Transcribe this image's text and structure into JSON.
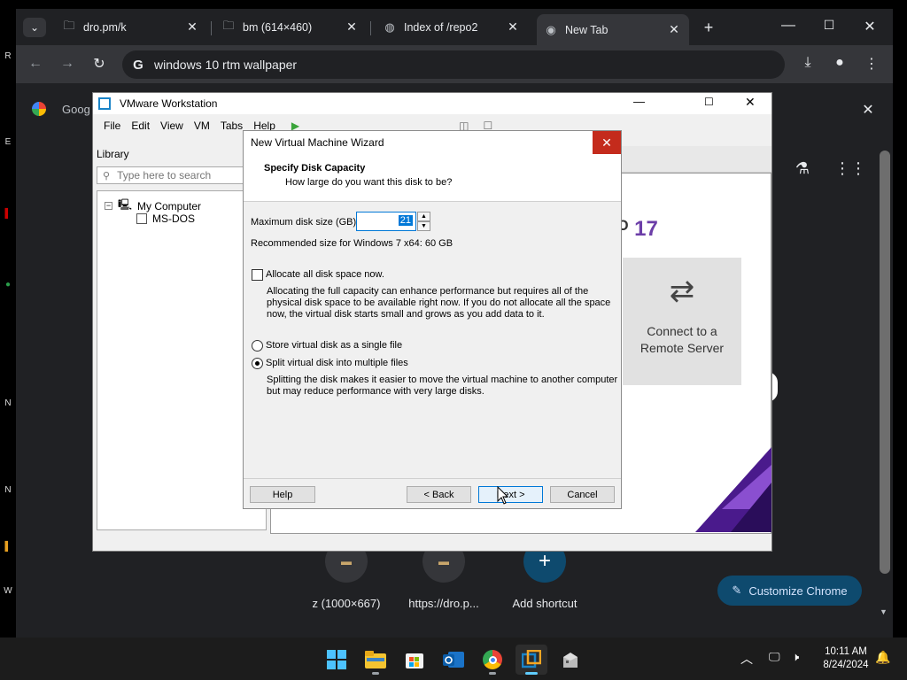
{
  "browser": {
    "tabs": [
      {
        "title": "dro.pm/k",
        "icon": "folder-icon"
      },
      {
        "title": "bm (614×460)",
        "icon": "folder-icon"
      },
      {
        "title": "Index of /repo2",
        "icon": "globe-icon"
      },
      {
        "title": "New Tab",
        "icon": "chrome-icon",
        "active": true
      }
    ],
    "omnibox_value": "windows 10 rtm wallpaper",
    "google_partial": "Goog",
    "shortcuts": [
      {
        "label": "z (1000×667)"
      },
      {
        "label": "https://dro.p..."
      },
      {
        "label": "Add shortcut"
      }
    ],
    "customize_label": "Customize Chrome"
  },
  "vmware": {
    "title": "VMware Workstation",
    "menu": [
      "File",
      "Edit",
      "View",
      "VM",
      "Tabs",
      "Help"
    ],
    "library_label": "Library",
    "search_placeholder": "Type here to search",
    "tree": {
      "root": "My Computer",
      "child": "MS-DOS"
    },
    "version_partial": "17",
    "connect_label_1": "Connect to a",
    "connect_label_2": "Remote Server"
  },
  "wizard": {
    "title": "New Virtual Machine Wizard",
    "heading": "Specify Disk Capacity",
    "subheading": "How large do you want this disk to be?",
    "max_size_label": "Maximum disk size (GB):",
    "max_size_value": "21",
    "recommended": "Recommended size for Windows 7 x64: 60 GB",
    "allocate_label": "Allocate all disk space now.",
    "allocate_desc_1": "Allocating the full capacity can enhance performance but requires all of the",
    "allocate_desc_2": "physical disk space to be available right now. If you do not allocate all the space",
    "allocate_desc_3": "now, the virtual disk starts small and grows as you add data to it.",
    "single_file_label": "Store virtual disk as a single file",
    "multi_file_label": "Split virtual disk into multiple files",
    "split_desc_1": "Splitting the disk makes it easier to move the virtual machine to another computer",
    "split_desc_2": "but may reduce performance with very large disks.",
    "help_label": "Help",
    "back_label": "< Back",
    "next_label": "Next >",
    "cancel_label": "Cancel"
  },
  "taskbar": {
    "time": "10:11 AM",
    "date": "8/24/2024"
  },
  "colors": {
    "chrome_bg": "#202124",
    "close_red": "#c42b1c",
    "vmware_purple": "#6c3ea8",
    "customize_bg": "#0e4a6e"
  }
}
